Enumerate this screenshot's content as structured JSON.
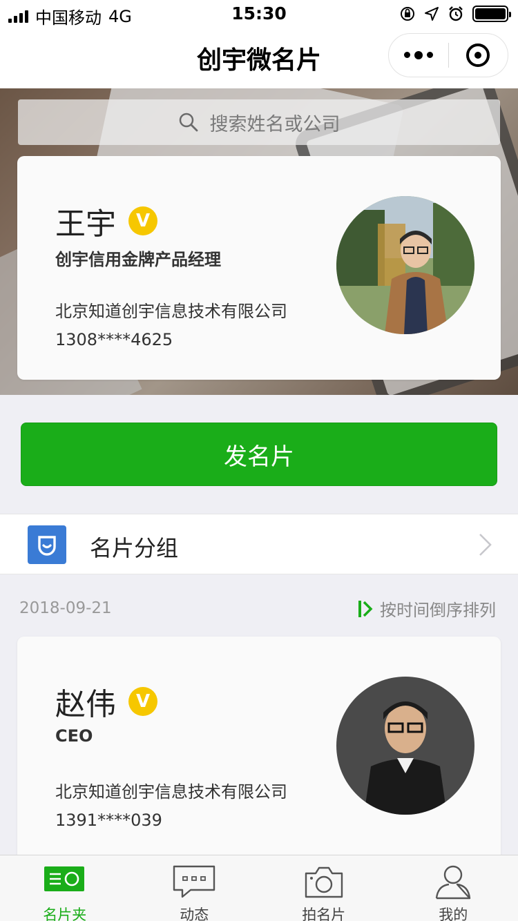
{
  "status_bar": {
    "carrier": "中国移动",
    "network": "4G",
    "time": "15:30"
  },
  "nav": {
    "title": "创宇微名片"
  },
  "search": {
    "placeholder": "搜索姓名或公司"
  },
  "my_card": {
    "name": "王宇",
    "badge": "V",
    "title": "创宇信用金牌产品经理",
    "company": "北京知道创宇信息技术有限公司",
    "phone": "1308****4625"
  },
  "send_button": {
    "label": "发名片"
  },
  "card_group": {
    "label": "名片分组"
  },
  "list_header": {
    "date": "2018-09-21",
    "sort_label": "按时间倒序排列"
  },
  "contacts": [
    {
      "name": "赵伟",
      "badge": "V",
      "title": "CEO",
      "company": "北京知道创宇信息技术有限公司",
      "phone": "1391****039"
    }
  ],
  "tab_bar": {
    "items": [
      {
        "label": "名片夹",
        "icon": "card-holder-icon",
        "active": true
      },
      {
        "label": "动态",
        "icon": "message-icon",
        "active": false
      },
      {
        "label": "拍名片",
        "icon": "camera-icon",
        "active": false
      },
      {
        "label": "我的",
        "icon": "person-icon",
        "active": false
      }
    ]
  },
  "colors": {
    "accent": "#1aad19",
    "badge": "#f6c700",
    "group_icon": "#3a7bd5"
  }
}
